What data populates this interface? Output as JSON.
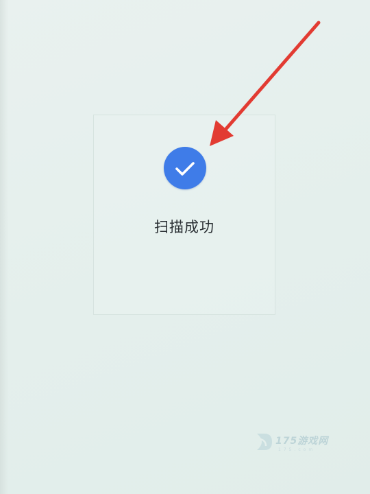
{
  "scan_result": {
    "icon": "check-circle-icon",
    "status_text": "扫描成功"
  },
  "annotation": {
    "icon": "red-arrow-pointer"
  },
  "watermark": {
    "brand": "175游戏网",
    "sub": "175.com"
  },
  "colors": {
    "background": "#e6f0ed",
    "success_blue": "#3f7ce8",
    "arrow_red": "#e23b32",
    "text": "#2a2f33"
  }
}
